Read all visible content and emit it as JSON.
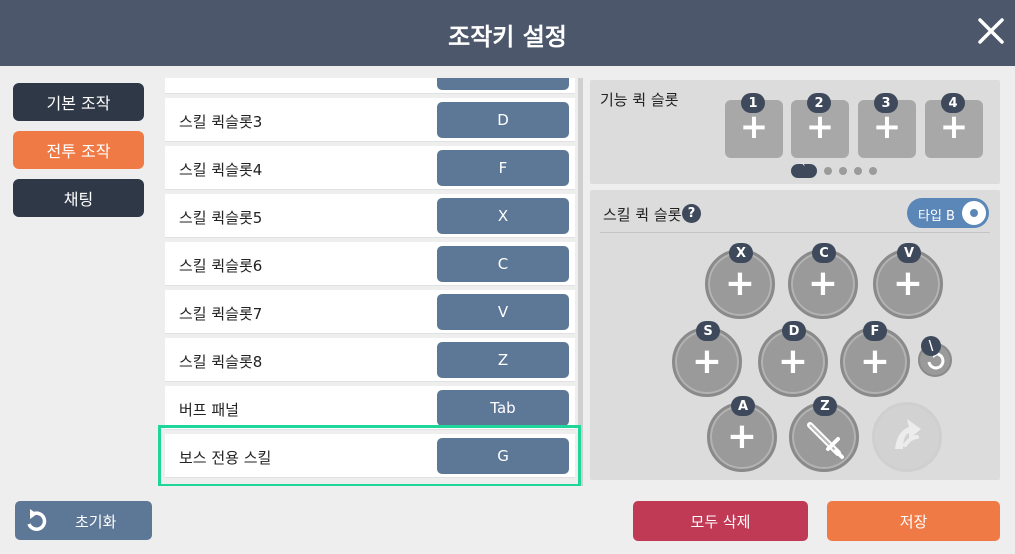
{
  "header": {
    "title": "조작키 설정"
  },
  "tabs": [
    {
      "label": "기본 조작",
      "active": false
    },
    {
      "label": "전투 조작",
      "active": true
    },
    {
      "label": "채팅",
      "active": false
    }
  ],
  "rows": [
    {
      "label": "",
      "key": ""
    },
    {
      "label": "스킬 퀵슬롯3",
      "key": "D"
    },
    {
      "label": "스킬 퀵슬롯4",
      "key": "F"
    },
    {
      "label": "스킬 퀵슬롯5",
      "key": "X"
    },
    {
      "label": "스킬 퀵슬롯6",
      "key": "C"
    },
    {
      "label": "스킬 퀵슬롯7",
      "key": "V"
    },
    {
      "label": "스킬 퀵슬롯8",
      "key": "Z"
    },
    {
      "label": "버프 패널",
      "key": "Tab"
    },
    {
      "label": "보스 전용 스킬",
      "key": "G"
    }
  ],
  "function_slots": {
    "title": "기능 퀵 슬롯",
    "slots": [
      {
        "badge": "1",
        "plus": "+"
      },
      {
        "badge": "2",
        "plus": "+"
      },
      {
        "badge": "3",
        "plus": "+"
      },
      {
        "badge": "4",
        "plus": "+"
      }
    ],
    "page_badge": "`",
    "page_count": 5,
    "active_page": 0
  },
  "skill_slots": {
    "title": "스킬 퀵 슬롯",
    "help": "?",
    "type_label": "타입 B",
    "skills": [
      {
        "badge": "X",
        "plus": "+"
      },
      {
        "badge": "C",
        "plus": "+"
      },
      {
        "badge": "V",
        "plus": "+"
      },
      {
        "badge": "S",
        "plus": "+"
      },
      {
        "badge": "D",
        "plus": "+"
      },
      {
        "badge": "F",
        "plus": "+"
      },
      {
        "badge": "A",
        "plus": "+"
      },
      {
        "badge": "Z",
        "icon": "sword-icon"
      },
      {
        "badge": "",
        "icon": "dodge-icon"
      }
    ],
    "mini_badge": "\\"
  },
  "footer": {
    "reset_label": "초기화",
    "delete_all_label": "모두 삭제",
    "save_label": "저장"
  },
  "colors": {
    "header": "#4c576b",
    "key_button": "#5d7796",
    "active_tab": "#ef7a45",
    "highlight": "#1fd69a",
    "delete": "#c03a56"
  }
}
